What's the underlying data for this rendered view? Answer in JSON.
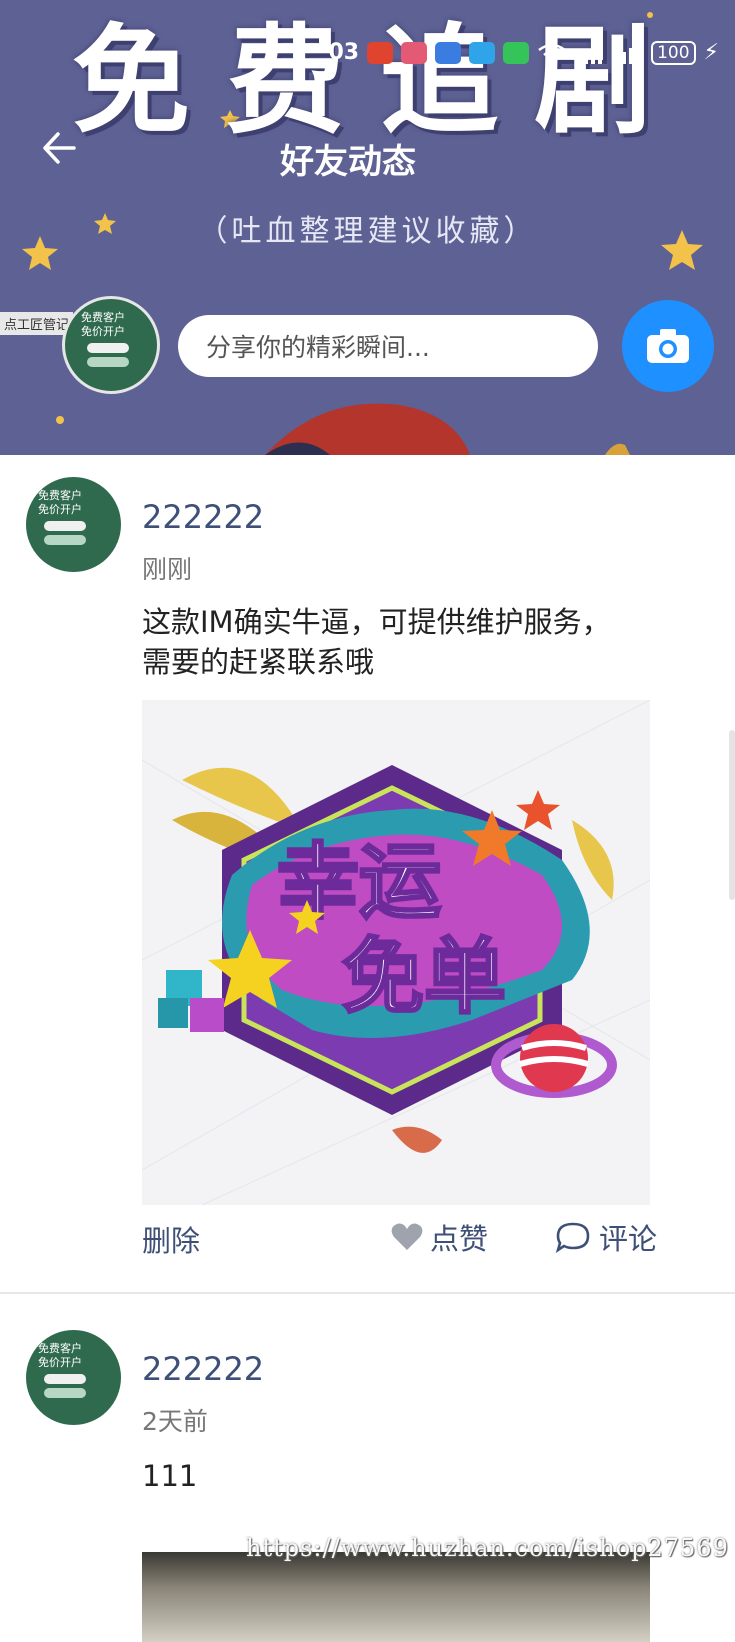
{
  "status_bar": {
    "time": "03",
    "battery": "100"
  },
  "banner": {
    "title": "免费追剧",
    "subtitle": "（吐血整理建议收藏）",
    "watermark_text": "点工匠管记"
  },
  "header": {
    "back_icon": "arrow-left-icon",
    "title": "好友动态"
  },
  "composer": {
    "placeholder": "分享你的精彩瞬间...",
    "camera_icon": "camera-icon",
    "avatar_lines": [
      "免费客户",
      "免价开户"
    ]
  },
  "posts": [
    {
      "username": "222222",
      "time": "刚刚",
      "text": "这款IM确实牛逼，可提供维护服务，需要的赶紧联系哦",
      "image": {
        "line1": "幸运",
        "line2": "免单"
      },
      "actions": {
        "delete": "删除",
        "like": "点赞",
        "comment": "评论"
      }
    },
    {
      "username": "222222",
      "time": "2天前",
      "text": "111"
    }
  ],
  "site_watermark": "https://www.huzhan.com/ishop27569",
  "colors": {
    "banner_bg": "#5e6193",
    "accent_blue": "#1e90ff",
    "link_text": "#3e4f78"
  }
}
